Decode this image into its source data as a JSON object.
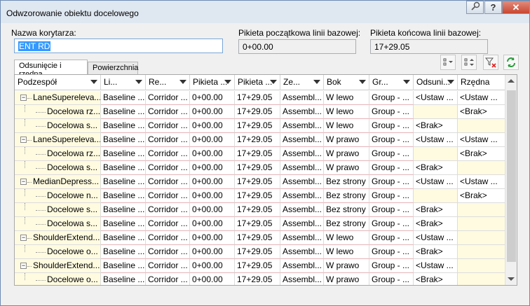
{
  "window": {
    "title": "Odwzorowanie obiektu docelowego"
  },
  "fields": {
    "corridor_name_label": "Nazwa korytarza:",
    "corridor_name_value": "ENT RD",
    "start_station_label": "Pikieta początkowa linii bazowej:",
    "start_station_value": "0+00.00",
    "end_station_label": "Pikieta końcowa linii bazowej:",
    "end_station_value": "17+29.05"
  },
  "tabs": [
    "Odsunięcie i rzędna",
    "Powierzchnia"
  ],
  "columns": [
    "Podzespół",
    "Li...",
    "Re...",
    "Pikieta ...",
    "Pikieta ...",
    "Ze...",
    "Bok",
    "Gr...",
    "Odsuni...",
    "Rzędna"
  ],
  "rows": [
    {
      "name": "LaneSupereleva...",
      "level": 0,
      "li": "Baseline ...",
      "re": "Corridor ...",
      "p1": "0+00.00",
      "p2": "17+29.05",
      "ze": "Assembl...",
      "bok": "W lewo",
      "gr": "Group - ...",
      "od": "<Ustaw ...",
      "rz": "<Ustaw ..."
    },
    {
      "name": "Docelowa rz...",
      "level": 1,
      "li": "Baseline ...",
      "re": "Corridor ...",
      "p1": "0+00.00",
      "p2": "17+29.05",
      "ze": "Assembl...",
      "bok": "W lewo",
      "gr": "Group - ...",
      "od": "",
      "rz": "<Brak>"
    },
    {
      "name": "Docelowa s...",
      "level": 1,
      "li": "Baseline ...",
      "re": "Corridor ...",
      "p1": "0+00.00",
      "p2": "17+29.05",
      "ze": "Assembl...",
      "bok": "W lewo",
      "gr": "Group - ...",
      "od": "<Brak>",
      "rz": ""
    },
    {
      "name": "LaneSupereleva...",
      "level": 0,
      "li": "Baseline ...",
      "re": "Corridor ...",
      "p1": "0+00.00",
      "p2": "17+29.05",
      "ze": "Assembl...",
      "bok": "W prawo",
      "gr": "Group - ...",
      "od": "<Ustaw ...",
      "rz": "<Ustaw ..."
    },
    {
      "name": "Docelowa rz...",
      "level": 1,
      "li": "Baseline ...",
      "re": "Corridor ...",
      "p1": "0+00.00",
      "p2": "17+29.05",
      "ze": "Assembl...",
      "bok": "W prawo",
      "gr": "Group - ...",
      "od": "",
      "rz": "<Brak>"
    },
    {
      "name": "Docelowa s...",
      "level": 1,
      "li": "Baseline ...",
      "re": "Corridor ...",
      "p1": "0+00.00",
      "p2": "17+29.05",
      "ze": "Assembl...",
      "bok": "W prawo",
      "gr": "Group - ...",
      "od": "<Brak>",
      "rz": ""
    },
    {
      "name": "MedianDepress...",
      "level": 0,
      "li": "Baseline ...",
      "re": "Corridor ...",
      "p1": "0+00.00",
      "p2": "17+29.05",
      "ze": "Assembl...",
      "bok": "Bez strony",
      "gr": "Group - ...",
      "od": "<Ustaw ...",
      "rz": "<Ustaw ..."
    },
    {
      "name": "Docelowe n...",
      "level": 1,
      "li": "Baseline ...",
      "re": "Corridor ...",
      "p1": "0+00.00",
      "p2": "17+29.05",
      "ze": "Assembl...",
      "bok": "Bez strony",
      "gr": "Group - ...",
      "od": "",
      "rz": "<Brak>"
    },
    {
      "name": "Docelowe s...",
      "level": 1,
      "li": "Baseline ...",
      "re": "Corridor ...",
      "p1": "0+00.00",
      "p2": "17+29.05",
      "ze": "Assembl...",
      "bok": "Bez strony",
      "gr": "Group - ...",
      "od": "<Brak>",
      "rz": ""
    },
    {
      "name": "Docelowa s...",
      "level": 1,
      "li": "Baseline ...",
      "re": "Corridor ...",
      "p1": "0+00.00",
      "p2": "17+29.05",
      "ze": "Assembl...",
      "bok": "Bez strony",
      "gr": "Group - ...",
      "od": "<Brak>",
      "rz": ""
    },
    {
      "name": "ShoulderExtend...",
      "level": 0,
      "li": "Baseline ...",
      "re": "Corridor ...",
      "p1": "0+00.00",
      "p2": "17+29.05",
      "ze": "Assembl...",
      "bok": "W lewo",
      "gr": "Group - ...",
      "od": "<Ustaw ...",
      "rz": ""
    },
    {
      "name": "Docelowe o...",
      "level": 1,
      "li": "Baseline ...",
      "re": "Corridor ...",
      "p1": "0+00.00",
      "p2": "17+29.05",
      "ze": "Assembl...",
      "bok": "W lewo",
      "gr": "Group - ...",
      "od": "<Brak>",
      "rz": ""
    },
    {
      "name": "ShoulderExtend...",
      "level": 0,
      "li": "Baseline ...",
      "re": "Corridor ...",
      "p1": "0+00.00",
      "p2": "17+29.05",
      "ze": "Assembl...",
      "bok": "W prawo",
      "gr": "Group - ...",
      "od": "<Ustaw ...",
      "rz": ""
    },
    {
      "name": "Docelowe o...",
      "level": 1,
      "li": "Baseline ...",
      "re": "Corridor ...",
      "p1": "0+00.00",
      "p2": "17+29.05",
      "ze": "Assembl...",
      "bok": "W prawo",
      "gr": "Group - ...",
      "od": "<Brak>",
      "rz": ""
    }
  ],
  "icons": {
    "help": "?",
    "close": "✕"
  },
  "colors": {
    "accent_blue": "#3399ff",
    "row_yellow": "#fffbe0",
    "refresh_green": "#2e9b3e"
  }
}
